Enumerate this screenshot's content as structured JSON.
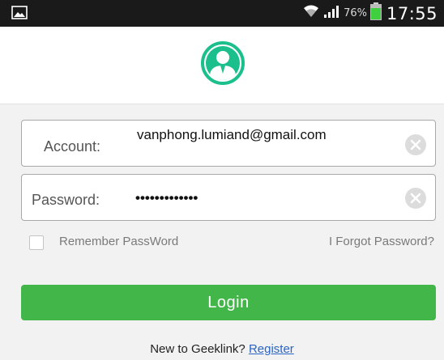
{
  "status_bar": {
    "battery_percent": "76%",
    "time": "17:55"
  },
  "login_form": {
    "account_label": "Account:",
    "account_value": "vanphong.lumiand@gmail.com",
    "password_label": "Password:",
    "password_value": "•••••••••••••",
    "remember_label": "Remember PassWord",
    "remember_checked": false,
    "forgot_label": "I Forgot Password?",
    "login_label": "Login"
  },
  "footer": {
    "prompt": "New to Geeklink?",
    "register_label": "Register"
  },
  "colors": {
    "accent_green": "#43b649",
    "logo_teal": "#1bbf8c",
    "link_blue": "#2a64c4"
  }
}
